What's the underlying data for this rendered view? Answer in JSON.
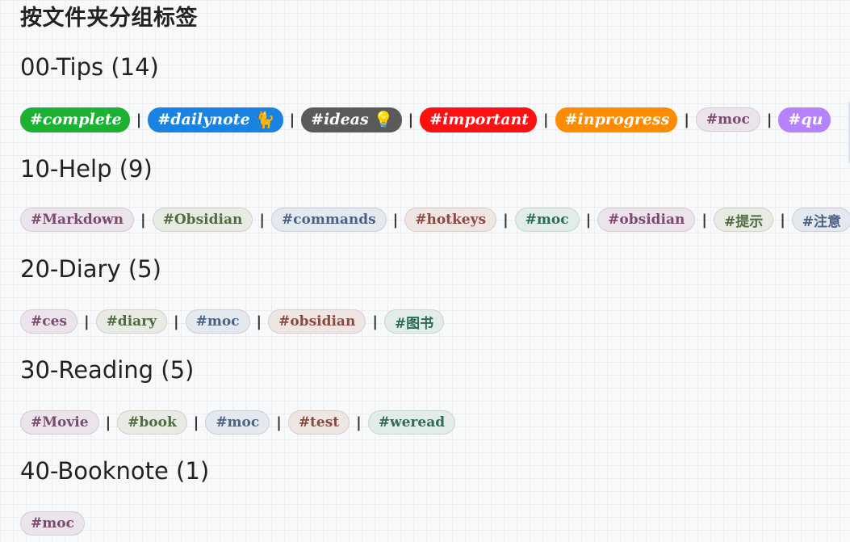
{
  "page_title": "按文件夹分组标签",
  "sections": [
    {
      "heading": "00-Tips (14)",
      "tags": [
        {
          "label": "#complete",
          "style": "fancy",
          "bg": "#1db134",
          "color": "#ffffff"
        },
        {
          "label": "#dailynote",
          "style": "fancy",
          "bg": "#1a82e0",
          "color": "#ffffff",
          "emoji": "🐈"
        },
        {
          "label": "#ideas",
          "style": "fancy",
          "bg": "#5a5a5a",
          "color": "#ffffff",
          "emoji": "💡"
        },
        {
          "label": "#important",
          "style": "fancy",
          "bg": "#ff1111",
          "color": "#ffffff"
        },
        {
          "label": "#inprogress",
          "style": "fancy",
          "bg": "#ff8c00",
          "color": "#ffffff"
        },
        {
          "label": "#moc",
          "style": "plain",
          "bg": "#ebe4ea",
          "color": "#7a4a6f"
        },
        {
          "label": "#qu",
          "style": "fancy",
          "bg": "#b583ff",
          "color": "#ffffff"
        }
      ]
    },
    {
      "heading": "10-Help (9)",
      "tags": [
        {
          "label": "#Markdown",
          "style": "plain",
          "bg": "#ebe4ea",
          "color": "#7a4a6f"
        },
        {
          "label": "#Obsidian",
          "style": "plain",
          "bg": "#e7ebe3",
          "color": "#4f6b3f"
        },
        {
          "label": "#commands",
          "style": "plain",
          "bg": "#e4e8ef",
          "color": "#4a6384"
        },
        {
          "label": "#hotkeys",
          "style": "plain",
          "bg": "#efe6e3",
          "color": "#8a4a3e"
        },
        {
          "label": "#moc",
          "style": "plain",
          "bg": "#e2ece8",
          "color": "#2f6b5a"
        },
        {
          "label": "#obsidian",
          "style": "plain",
          "bg": "#ebe4ea",
          "color": "#7a4a6f"
        },
        {
          "label": "#提示",
          "style": "plain",
          "bg": "#e7ebe3",
          "color": "#4f6b3f"
        },
        {
          "label": "#注意",
          "style": "plain",
          "bg": "#e4e8ef",
          "color": "#4a6384"
        }
      ]
    },
    {
      "heading": "20-Diary (5)",
      "tags": [
        {
          "label": "#ces",
          "style": "plain",
          "bg": "#ebe4ea",
          "color": "#7a4a6f"
        },
        {
          "label": "#diary",
          "style": "plain",
          "bg": "#e7ebe3",
          "color": "#4f6b3f"
        },
        {
          "label": "#moc",
          "style": "plain",
          "bg": "#e4e8ef",
          "color": "#4a6384"
        },
        {
          "label": "#obsidian",
          "style": "plain",
          "bg": "#efe6e3",
          "color": "#8a4a3e"
        },
        {
          "label": "#图书",
          "style": "plain",
          "bg": "#e2ece8",
          "color": "#2f6b5a"
        }
      ]
    },
    {
      "heading": "30-Reading (5)",
      "tags": [
        {
          "label": "#Movie",
          "style": "plain",
          "bg": "#ebe4ea",
          "color": "#7a4a6f"
        },
        {
          "label": "#book",
          "style": "plain",
          "bg": "#e7ebe3",
          "color": "#4f6b3f"
        },
        {
          "label": "#moc",
          "style": "plain",
          "bg": "#e4e8ef",
          "color": "#4a6384"
        },
        {
          "label": "#test",
          "style": "plain",
          "bg": "#efe6e3",
          "color": "#8a4a3e"
        },
        {
          "label": "#weread",
          "style": "plain",
          "bg": "#e2ece8",
          "color": "#2f6b5a"
        }
      ]
    },
    {
      "heading": "40-Booknote (1)",
      "tags": [
        {
          "label": "#moc",
          "style": "plain",
          "bg": "#ebe4ea",
          "color": "#7a4a6f"
        }
      ]
    }
  ],
  "separator": "|"
}
